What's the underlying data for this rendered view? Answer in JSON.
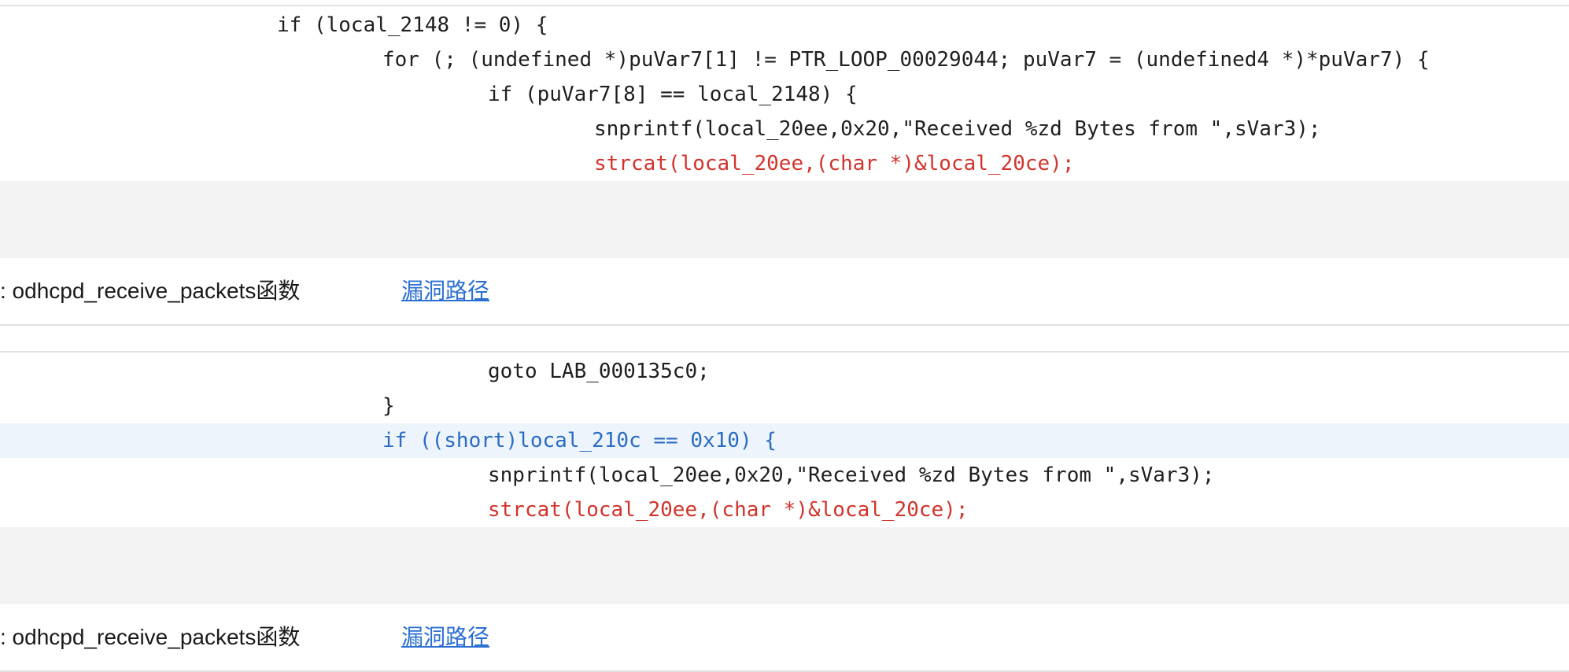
{
  "blocks": [
    {
      "code_lines": [
        {
          "text": "if (local_2148 != 0) {",
          "style": "normal"
        },
        {
          "text": "for (; (undefined *)puVar7[1] != PTR_LOOP_00029044; puVar7 = (undefined4 *)*puVar7) {",
          "style": "normal"
        },
        {
          "text": "if (puVar7[8] == local_2148) {",
          "style": "normal"
        },
        {
          "text": "snprintf(local_20ee,0x20,\"Received %zd Bytes from \",sVar3);",
          "style": "normal"
        },
        {
          "text": "strcat(local_20ee,(char *)&local_20ce);",
          "style": "red"
        }
      ],
      "function_label": ": odhcpd_receive_packets函数",
      "link_label": "漏洞路径"
    },
    {
      "code_lines": [
        {
          "text": "goto LAB_000135c0;",
          "style": "normal"
        },
        {
          "text": "}",
          "style": "normal"
        },
        {
          "text": "if ((short)local_210c == 0x10) {",
          "style": "blue"
        },
        {
          "text": "snprintf(local_20ee,0x20,\"Received %zd Bytes from \",sVar3);",
          "style": "normal"
        },
        {
          "text": "strcat(local_20ee,(char *)&local_20ce);",
          "style": "red"
        }
      ],
      "function_label": ": odhcpd_receive_packets函数",
      "link_label": "漏洞路径"
    }
  ],
  "colors": {
    "code_text": "#1f1f1f",
    "highlight_red": "#d0342c",
    "highlight_blue": "#2a6cc4",
    "link": "#2c6fd3",
    "gray_area": "#f3f3f3"
  }
}
